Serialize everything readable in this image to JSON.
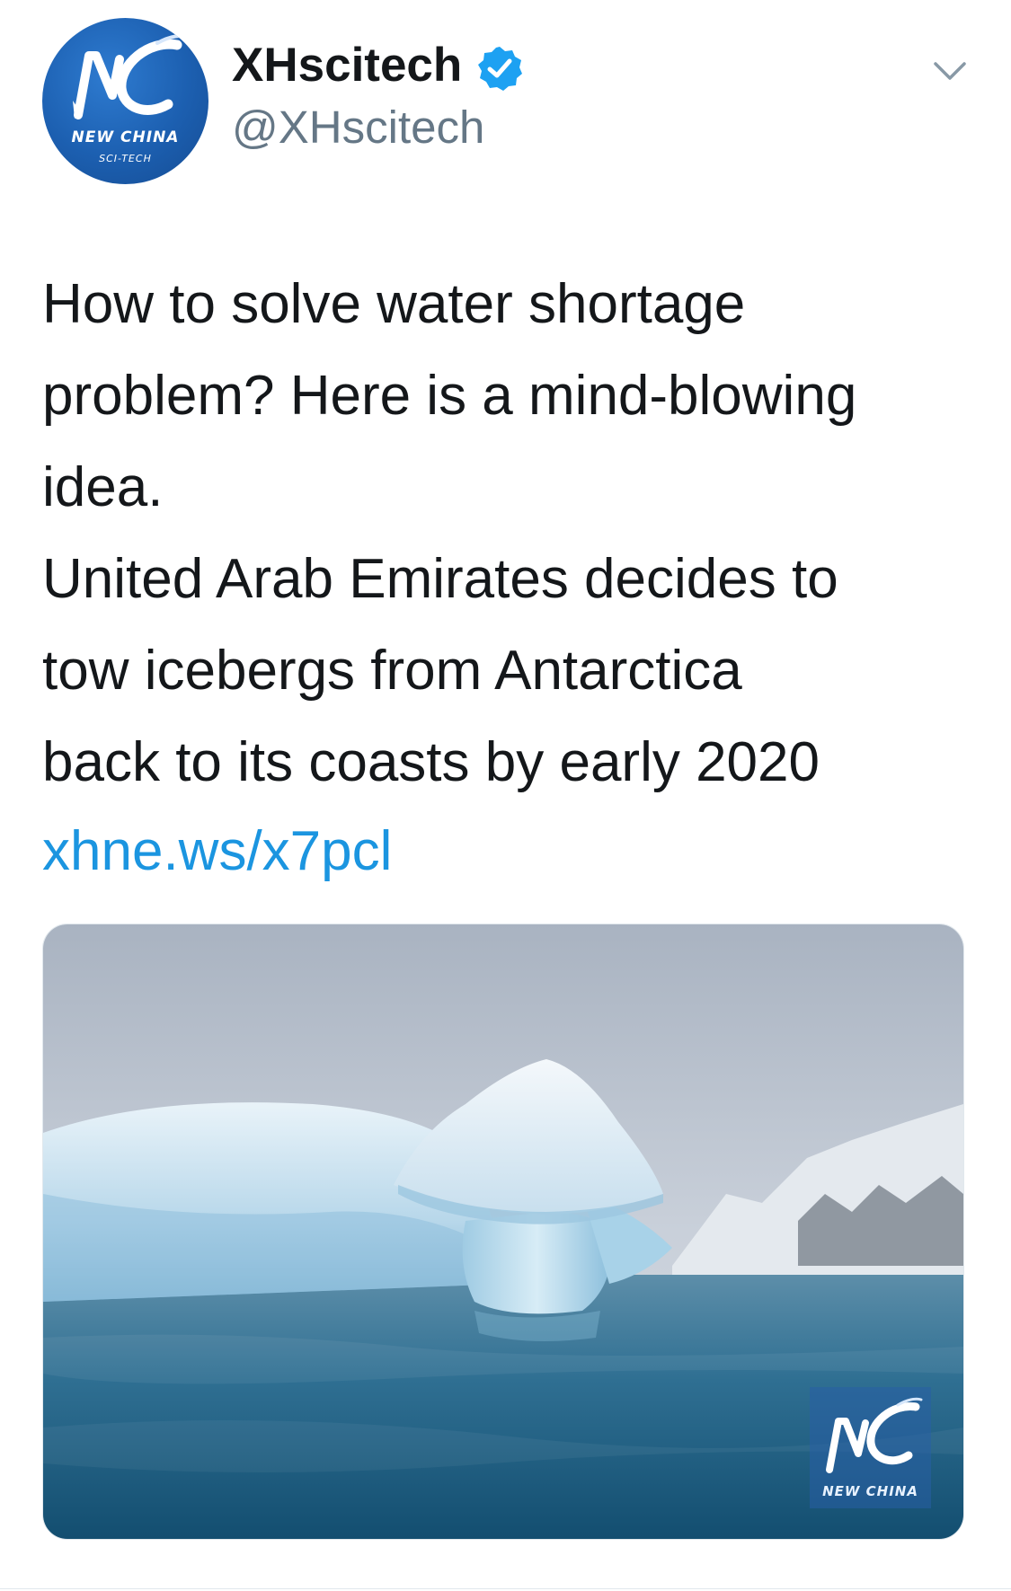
{
  "tweet": {
    "author": {
      "display_name": "XHscitech",
      "handle": "@XHscitech",
      "verified": true,
      "avatar": {
        "logo_text": "NC",
        "line1": "NEW CHINA",
        "line2": "SCI-TECH"
      }
    },
    "menu_icon": "chevron-down-icon",
    "text_lines": [
      "How to solve water shortage",
      "problem? Here is a mind-blowing",
      "idea.",
      "United Arab Emirates decides to",
      "tow icebergs from Antarctica",
      "back to its coasts by early 2020"
    ],
    "link": "xhne.ws/x7pcl",
    "media": {
      "watermark_logo": "NC",
      "watermark_text": "NEW CHINA"
    }
  },
  "colors": {
    "text": "#14171a",
    "secondary": "#657786",
    "link": "#1b95e0",
    "verified": "#1da1f2"
  }
}
